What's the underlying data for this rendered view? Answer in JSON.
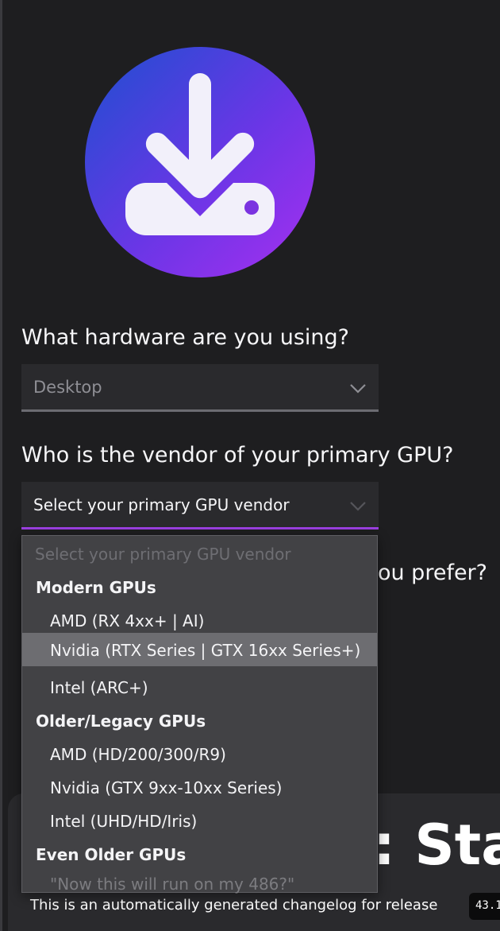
{
  "questions": {
    "hardware": "What hardware are you using?",
    "gpu_vendor": "Who is the vendor of your primary GPU?",
    "prefer_partial": "ou prefer?"
  },
  "hardware_select": {
    "value": "Desktop"
  },
  "gpu_select": {
    "value": "Select your primary GPU vendor"
  },
  "dropdown": {
    "placeholder": "Select your primary GPU vendor",
    "groups": [
      {
        "label": "Modern GPUs",
        "options": [
          "AMD (RX 4xx+ | AI)",
          "Nvidia (RTX Series | GTX 16xx Series+)",
          "Intel (ARC+)"
        ]
      },
      {
        "label": "Older/Legacy GPUs",
        "options": [
          "AMD (HD/200/300/R9)",
          "Nvidia (GTX 9xx-10xx Series)",
          "Intel (UHD/HD/Iris)"
        ]
      },
      {
        "label": "Even Older GPUs",
        "options": [
          "\"Now this will run on my 486?\""
        ]
      }
    ],
    "highlighted_option": "Nvidia (RTX Series | GTX 16xx Series+)"
  },
  "release": {
    "title_partial": ": Stab",
    "changelog_text": "This is an automatically generated changelog for release",
    "version_chip": "43.1"
  },
  "colors": {
    "background": "#1e1e20",
    "accent": "#9b3fe0",
    "logo_gradient_start": "#1e4fd0",
    "logo_gradient_end": "#a62ff0"
  },
  "icons": {
    "logo": "download-drive-icon",
    "chevron": "chevron-down-icon"
  }
}
